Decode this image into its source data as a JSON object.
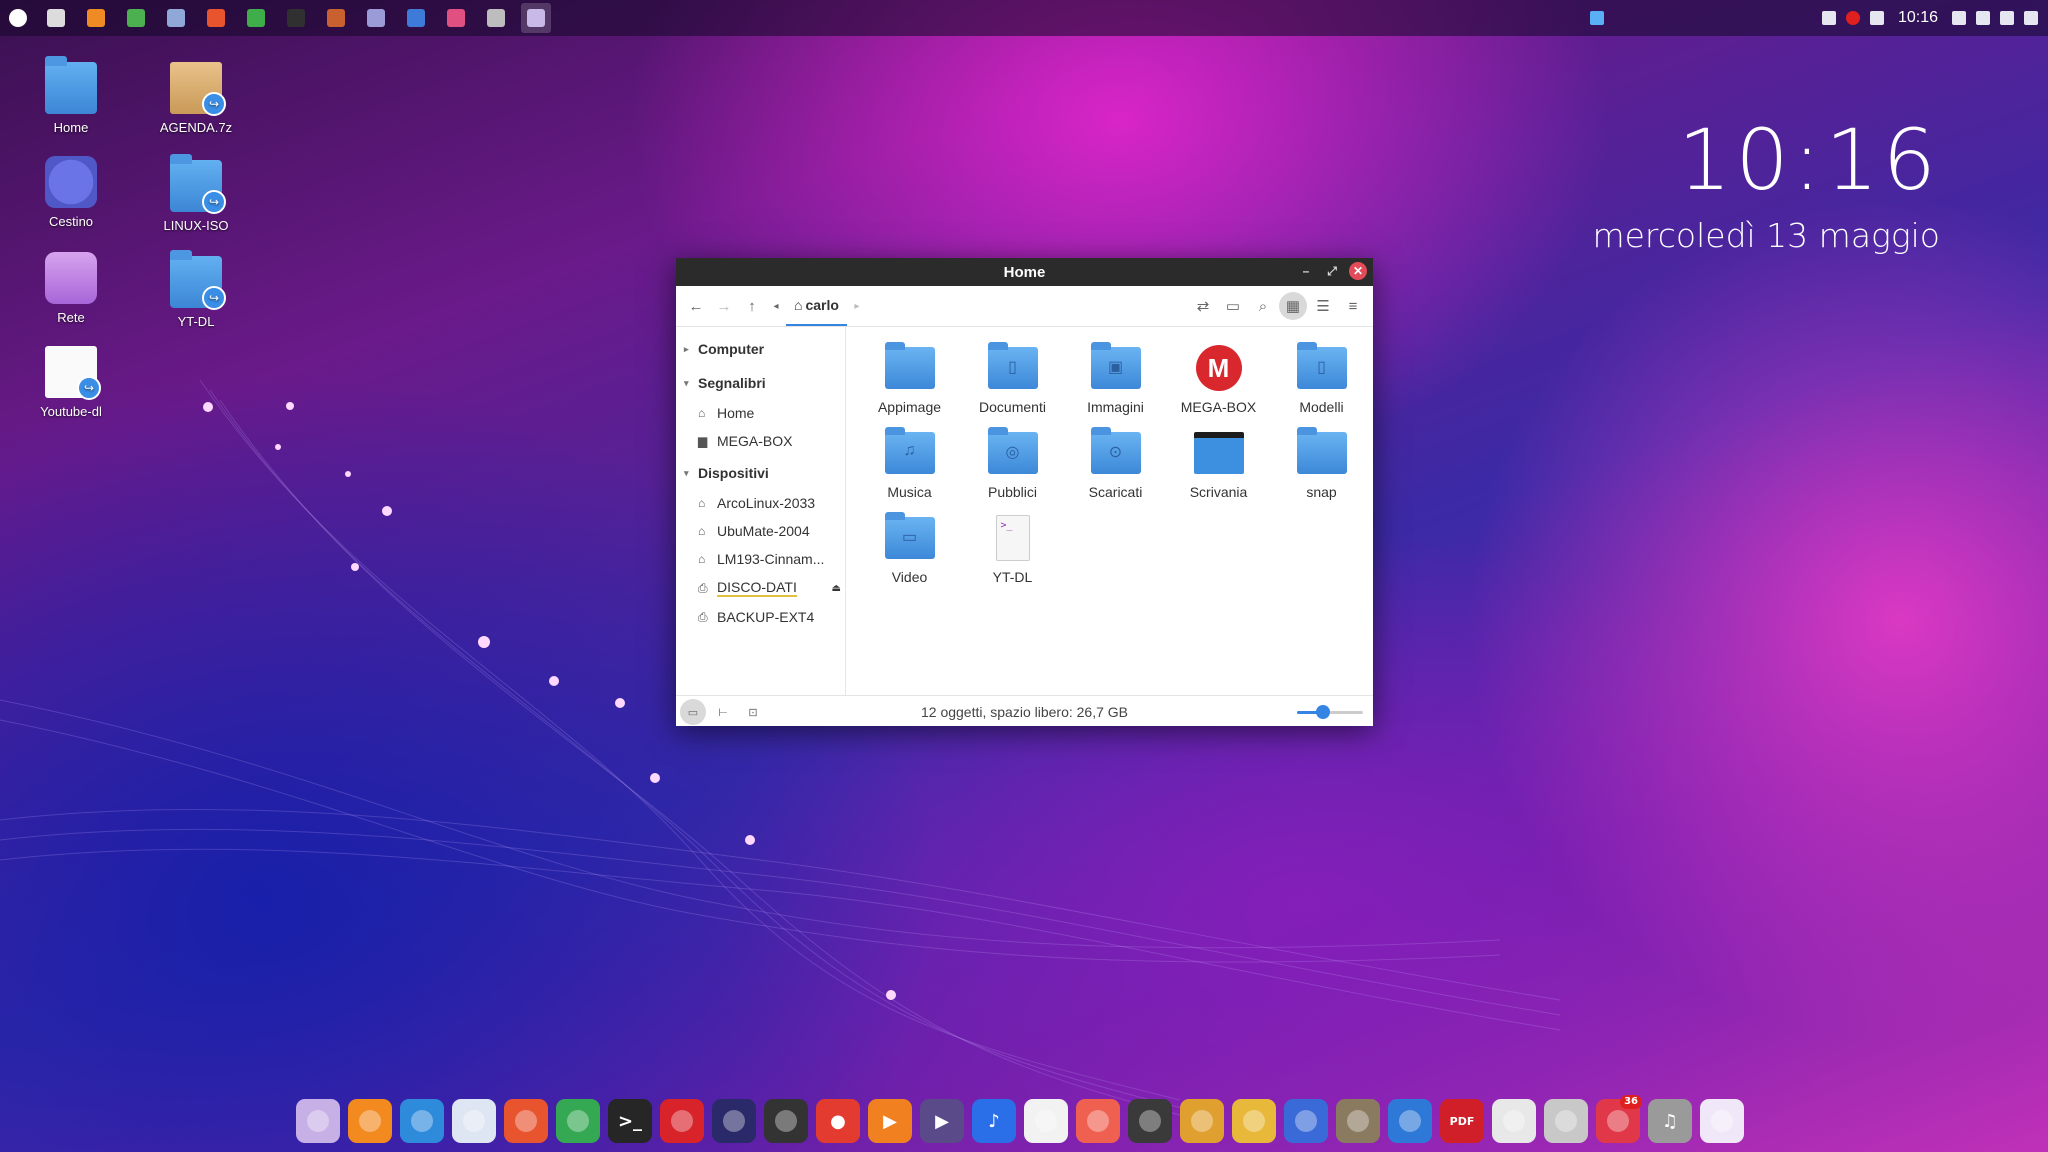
{
  "top_panel": {
    "apps": [
      {
        "name": "files-panel-app",
        "color": "#dcdcdc"
      },
      {
        "name": "firefox-panel-app",
        "color": "#f08a24"
      },
      {
        "name": "chrome-panel-app",
        "color": "#4caf50"
      },
      {
        "name": "grid-panel-app",
        "color": "#8fa8d8"
      },
      {
        "name": "download-panel-app",
        "color": "#e8542e"
      },
      {
        "name": "sync-panel-app",
        "color": "#3fae4a"
      },
      {
        "name": "terminal-panel-app",
        "color": "#303030"
      },
      {
        "name": "mosaic-panel-app",
        "color": "#c86030"
      },
      {
        "name": "notes-panel-app",
        "color": "#9b9bd8"
      },
      {
        "name": "screenshot-panel-app",
        "color": "#3e7ad8"
      },
      {
        "name": "camera-panel-app",
        "color": "#e05080"
      },
      {
        "name": "tweaks-panel-app",
        "color": "#bdbdbd"
      },
      {
        "name": "nemo-panel-app",
        "color": "#c9b9e8"
      }
    ],
    "clock": "10:16"
  },
  "desktop_icons": [
    {
      "label": "Home",
      "type": "folder"
    },
    {
      "label": "AGENDA.7z",
      "type": "archive"
    },
    {
      "label": "Cestino",
      "type": "trash"
    },
    {
      "label": "LINUX-ISO",
      "type": "folder-link"
    },
    {
      "label": "Rete",
      "type": "network"
    },
    {
      "label": "YT-DL",
      "type": "folder-link"
    },
    {
      "label": "Youtube-dl",
      "type": "doc-link"
    }
  ],
  "big_clock": {
    "time": "10:16",
    "date": "mercoledì 13 maggio"
  },
  "window": {
    "title": "Home",
    "breadcrumb": "carlo",
    "sidebar": {
      "computer": "Computer",
      "bookmarks": "Segnalibri",
      "bookmark_items": [
        "Home",
        "MEGA-BOX"
      ],
      "devices": "Dispositivi",
      "device_items": [
        "ArcoLinux-2033",
        "UbuMate-2004",
        "LM193-Cinnam...",
        "DISCO-DATI",
        "BACKUP-EXT4"
      ]
    },
    "items": [
      {
        "label": "Appimage",
        "kind": "folder",
        "glyph": ""
      },
      {
        "label": "Documenti",
        "kind": "folder",
        "glyph": "▯"
      },
      {
        "label": "Immagini",
        "kind": "folder",
        "glyph": "▣"
      },
      {
        "label": "MEGA-BOX",
        "kind": "mega",
        "glyph": "M"
      },
      {
        "label": "Modelli",
        "kind": "folder",
        "glyph": "▯"
      },
      {
        "label": "Musica",
        "kind": "folder",
        "glyph": "♫"
      },
      {
        "label": "Pubblici",
        "kind": "folder",
        "glyph": "◎"
      },
      {
        "label": "Scaricati",
        "kind": "folder",
        "glyph": "⊙"
      },
      {
        "label": "Scrivania",
        "kind": "desktop",
        "glyph": ""
      },
      {
        "label": "snap",
        "kind": "folder",
        "glyph": ""
      },
      {
        "label": "Video",
        "kind": "folder",
        "glyph": "▭"
      },
      {
        "label": "YT-DL",
        "kind": "file",
        "glyph": ">_"
      }
    ],
    "status": "12 oggetti, spazio libero: 26,7 GB",
    "zoom_level": 0.4
  },
  "dock": [
    {
      "name": "files-dock-app",
      "color": "#c6b0e6",
      "glyph": ""
    },
    {
      "name": "firefox-dock-app",
      "color": "#f38a1f",
      "glyph": ""
    },
    {
      "name": "chrome-dock-app",
      "color": "#2e8bdc",
      "glyph": ""
    },
    {
      "name": "grid-dock-app",
      "color": "#dfe6f3",
      "glyph": ""
    },
    {
      "name": "download-dock-app",
      "color": "#e8542e",
      "glyph": ""
    },
    {
      "name": "sync-dock-app",
      "color": "#35a853",
      "glyph": ""
    },
    {
      "name": "terminal-dock-app",
      "color": "#262626",
      "glyph": ">_"
    },
    {
      "name": "install-dock-app",
      "color": "#d8232a",
      "glyph": ""
    },
    {
      "name": "audio-dock-app",
      "color": "#2a2a6a",
      "glyph": ""
    },
    {
      "name": "video-editor-dock-app",
      "color": "#333333",
      "glyph": ""
    },
    {
      "name": "record-dock-app",
      "color": "#e33b2f",
      "glyph": "●"
    },
    {
      "name": "play-dock-app",
      "color": "#f08020",
      "glyph": "▶"
    },
    {
      "name": "media-dock-app",
      "color": "#5a4a8a",
      "glyph": "▶"
    },
    {
      "name": "music-dock-app",
      "color": "#2a6ee8",
      "glyph": "♪"
    },
    {
      "name": "notes-music-dock-app",
      "color": "#f2f2f2",
      "glyph": ""
    },
    {
      "name": "refresh-dock-app",
      "color": "#f06050",
      "glyph": ""
    },
    {
      "name": "radio-dock-app",
      "color": "#3a3a3a",
      "glyph": ""
    },
    {
      "name": "cocktail-dock-app",
      "color": "#e0a030",
      "glyph": ""
    },
    {
      "name": "wine-dock-app",
      "color": "#e8b83a",
      "glyph": ""
    },
    {
      "name": "windows-dock-app",
      "color": "#3a6ad8",
      "glyph": ""
    },
    {
      "name": "gimp-dock-app",
      "color": "#8a7a60",
      "glyph": ""
    },
    {
      "name": "writer-dock-app",
      "color": "#2e78d8",
      "glyph": ""
    },
    {
      "name": "pdf-dock-app",
      "color": "#d01f28",
      "glyph": "PDF"
    },
    {
      "name": "color-dock-app",
      "color": "#e8e8e8",
      "glyph": ""
    },
    {
      "name": "disk-dock-app",
      "color": "#c8c8c8",
      "glyph": ""
    },
    {
      "name": "mail-dock-app",
      "color": "#e03848",
      "glyph": "",
      "badge": "36"
    },
    {
      "name": "sound-dock-app",
      "color": "#9a9a9a",
      "glyph": "♫"
    },
    {
      "name": "settings-dock-app",
      "color": "#f0e8f8",
      "glyph": ""
    }
  ]
}
